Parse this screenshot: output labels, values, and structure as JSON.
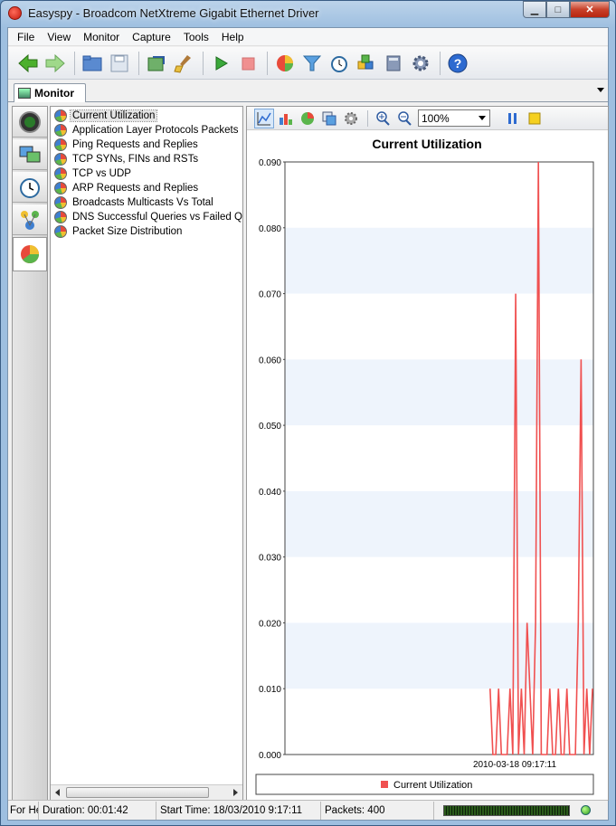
{
  "window": {
    "title": "Easyspy - Broadcom NetXtreme Gigabit Ethernet Driver",
    "controls": {
      "minimize": "▁",
      "maximize": "□",
      "close": "✕"
    }
  },
  "menu": [
    "File",
    "View",
    "Monitor",
    "Capture",
    "Tools",
    "Help"
  ],
  "toolbar_icons": [
    "back-icon",
    "forward-icon",
    "open-folder-icon",
    "save-icon",
    "export-icon",
    "clear-icon",
    "start-capture-icon",
    "stop-capture-icon",
    "statistics-icon",
    "filter-icon",
    "schedule-icon",
    "packets-icon",
    "log-icon",
    "settings-icon",
    "help-icon"
  ],
  "tab": {
    "label": "Monitor"
  },
  "rail_icons": [
    "radar-icon",
    "monitors-icon",
    "clock-icon",
    "network-icon",
    "pie-chart-icon"
  ],
  "tree": {
    "items": [
      {
        "label": "Current Utilization",
        "selected": true
      },
      {
        "label": "Application Layer Protocols Packets"
      },
      {
        "label": "Ping Requests and Replies"
      },
      {
        "label": "TCP SYNs, FINs and RSTs"
      },
      {
        "label": "TCP vs UDP"
      },
      {
        "label": "ARP Requests and Replies"
      },
      {
        "label": "Broadcasts Multicasts Vs Total"
      },
      {
        "label": "DNS Successful Queries vs Failed Queries"
      },
      {
        "label": "Packet Size Distribution"
      }
    ]
  },
  "chart_toolbar": {
    "zoom": "100%"
  },
  "chart_data": {
    "type": "line",
    "title": "Current Utilization",
    "xlabel": "",
    "ylabel": "",
    "x_tick_label": "2010-03-18 09:17:11",
    "ylim": [
      0,
      0.09
    ],
    "yticks": [
      "0.000",
      "0.010",
      "0.020",
      "0.030",
      "0.040",
      "0.050",
      "0.060",
      "0.070",
      "0.080",
      "0.090"
    ],
    "grid_bands": true,
    "legend": "bottom",
    "series": [
      {
        "name": "Current Utilization",
        "color": "#f05050",
        "values": [
          0.01,
          0,
          0,
          0.01,
          0,
          0,
          0,
          0.01,
          0,
          0.07,
          0,
          0.01,
          0,
          0.02,
          0.01,
          0,
          0.02,
          0.09,
          0,
          0,
          0,
          0.01,
          0,
          0,
          0.01,
          0,
          0,
          0.01,
          0,
          0,
          0,
          0.02,
          0.06,
          0,
          0.01,
          0,
          0.01
        ]
      }
    ]
  },
  "status": {
    "for_hint": "For He",
    "duration": "Duration: 00:01:42",
    "start_time": "Start Time: 18/03/2010 9:17:11",
    "packets": "Packets: 400"
  }
}
